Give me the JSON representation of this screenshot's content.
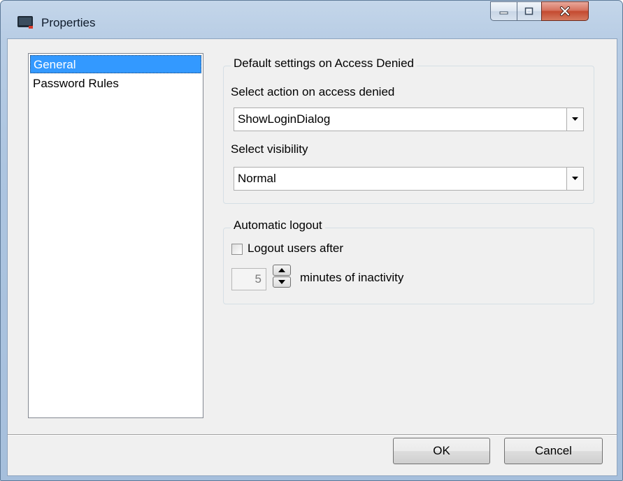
{
  "window": {
    "title": "Properties",
    "icon": "console-app-icon",
    "controls": [
      "minimize-icon",
      "maximize-icon",
      "close-icon"
    ]
  },
  "nav": {
    "items": [
      {
        "label": "General",
        "selected": true
      },
      {
        "label": "Password Rules",
        "selected": false
      }
    ]
  },
  "access_denied": {
    "legend": "Default settings on Access Denied",
    "action_label": "Select action on access denied",
    "action_value": "ShowLoginDialog",
    "visibility_label": "Select visibility",
    "visibility_value": "Normal"
  },
  "auto_logout": {
    "legend": "Automatic logout",
    "checkbox_label": "Logout users after",
    "checked": false,
    "minutes_value": "5",
    "minutes_suffix": "minutes of inactivity"
  },
  "buttons": {
    "ok": "OK",
    "cancel": "Cancel"
  },
  "colors": {
    "selection": "#3399ff",
    "dialog_bg": "#f0f0f0",
    "close_button": "#c44a30"
  }
}
